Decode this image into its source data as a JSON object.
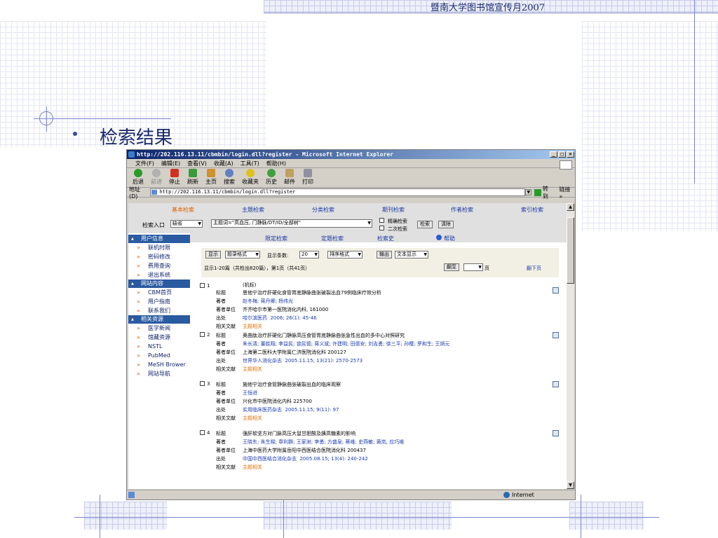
{
  "slide": {
    "header_title": "暨南大学图书馆宣传月2007",
    "title": "检索结果"
  },
  "browser": {
    "window_title": "http://202.116.13.11/cbmbin/login.dll?register - Microsoft Internet Explorer",
    "menu": [
      "文件(F)",
      "编辑(E)",
      "查看(V)",
      "收藏(A)",
      "工具(T)",
      "帮助(H)"
    ],
    "toolbar": {
      "back": "后退",
      "forward": "前进",
      "stop": "停止",
      "refresh": "刷新",
      "home": "主页",
      "search": "搜索",
      "favorites": "收藏夹",
      "history": "历史",
      "mail": "邮件",
      "print": "打印"
    },
    "address_label": "地址(D)",
    "address": "http://202.116.13.11/cbmbin/login.dll?register",
    "go_label": "转到",
    "links_label": "链接 »",
    "status_zone": "Internet"
  },
  "page": {
    "nav_tabs": [
      "基本检索",
      "主题检索",
      "分类检索",
      "期刊检索",
      "作者检索",
      "索引检索"
    ],
    "search_entry_label": "检索入口",
    "search_entry_value": "缺省",
    "query": "主题词=\"高血压, 门静脉/DT/ID/全部树\"",
    "exact_search": "精确检索",
    "secondary_search": "二次检索",
    "search_btn": "检索",
    "clear_btn": "清除",
    "sub_tabs": [
      "限定检索",
      "定题检索",
      "检索史",
      "帮助"
    ],
    "sidebar": {
      "sections": [
        {
          "title": "用户信息",
          "items": [
            "联机时限",
            "密码修改",
            "费用查询",
            "退出系统"
          ]
        },
        {
          "title": "网站内容",
          "items": [
            "CBM首页",
            "用户指南",
            "联系我们"
          ]
        },
        {
          "title": "相关资源",
          "items": [
            "医学新闻",
            "馆藏资源",
            "NSTL",
            "PubMed",
            "MeSH Brower",
            "网站导航"
          ]
        }
      ]
    },
    "results_bar": {
      "show_btn": "显示",
      "format_value": "题录格式",
      "count_label": "显示条数:",
      "count_value": "20",
      "sort_value": "排序格式",
      "export_btn": "输出",
      "output_value": "文本显示",
      "summary": "显示1-20篇（共检出820篇），第1页（共41页）",
      "goto_btn": "翻至",
      "page_unit": "页",
      "next_page": "翻下页"
    },
    "labels": {
      "title": "标题",
      "author": "著者",
      "affiliation": "著者单位",
      "source": "出处",
      "related": "相关文献"
    },
    "records": [
      {
        "num": "1",
        "tag": "(机标)",
        "title": "思他宁治疗肝硬化食管胃底静脉曲张破裂出血79例临床疗效分析",
        "authors": "赵冬梅; 蒋丹卿; 杨伟光",
        "affiliation": "齐齐哈尔市第一医院消化内科, 161000",
        "source_journal": "哈尔滨医药",
        "source_detail": "2006; 26(1): 45-46",
        "related": "主题相关"
      },
      {
        "num": "2",
        "title": "奥曲肽治疗肝硬化门静脉高压食管胃底静脉曲张急性出血的多中心对照研究",
        "authors": "朱长清; 董胜翔; 李益民; 曾民德; 蒋义斌; 许建明; 田德安; 刘吉勇; 徐三平; 孙樱; 罗和生; 王炳元",
        "affiliation": "上海第二医科大学附属仁济医院消化科 200127",
        "source_journal": "世界华人消化杂志",
        "source_detail": "2005.11.15; 13(21): 2570-2573",
        "related": "主题相关"
      },
      {
        "num": "3",
        "title": "施他宁治疗食管静脉曲张破裂出血的临床观察",
        "authors": "王恒进",
        "affiliation": "兴化市中医院消化内科 225700",
        "source_journal": "实用临床医药杂志",
        "source_detail": "2005.11.15; 9(11): 97",
        "related": "主题相关"
      },
      {
        "num": "4",
        "title": "强肝软坚方对门脉高压大鼠甘胆酸及胰高糖素的影响",
        "authors": "王晓东; 朱生樑; 章利群; 王家澍; 李勇; 方盛泉; 蔡维; 史燕敏; 黄岚; 应巧维",
        "affiliation": "上海中医药大学附属岳阳中西医结合医院消化科 200437",
        "source_journal": "中国中西医结合消化杂志",
        "source_detail": "2005.08.15; 13(4): 240-242",
        "related": "主题相关"
      }
    ]
  }
}
